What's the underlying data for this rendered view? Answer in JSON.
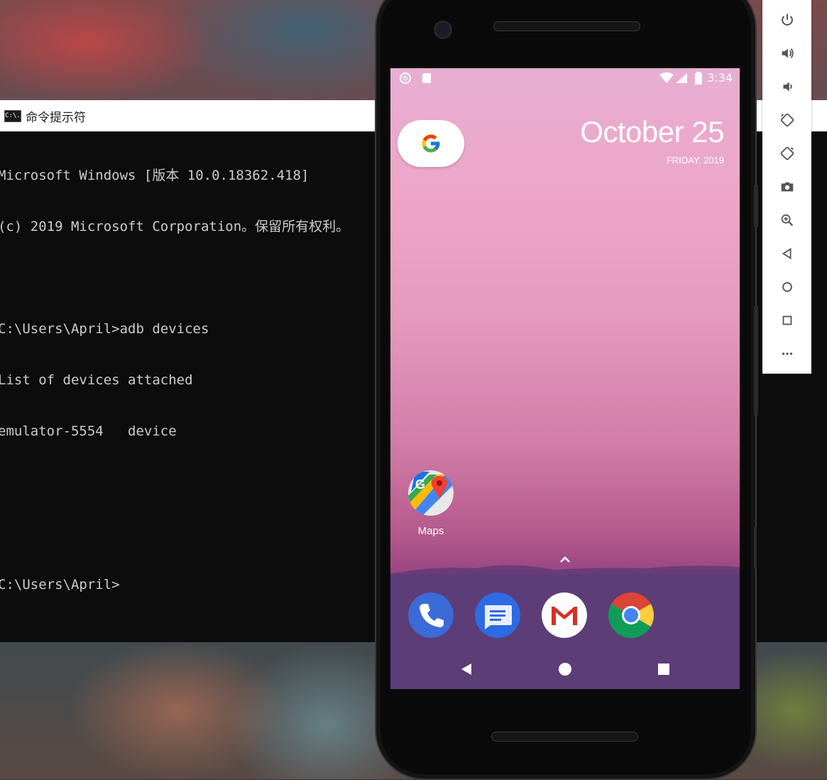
{
  "cmd": {
    "title": "命令提示符",
    "icon_text": "C:\\.",
    "lines": [
      "Microsoft Windows [版本 10.0.18362.418]",
      "(c) 2019 Microsoft Corporation。保留所有权利。",
      "",
      "C:\\Users\\April>adb devices",
      "List of devices attached",
      "emulator-5554   device",
      "",
      "",
      "C:\\Users\\April>"
    ]
  },
  "phone": {
    "status_time": "3:34",
    "date_main": "October 25",
    "date_sub": "FRIDAY, 2019",
    "apps": [
      {
        "label": "Maps",
        "icon": "maps-icon"
      }
    ],
    "dock": [
      "phone-icon",
      "messages-icon",
      "gmail-icon",
      "chrome-icon"
    ],
    "nav": [
      "back-icon",
      "home-icon",
      "recents-icon"
    ]
  },
  "toolbar": {
    "buttons": [
      "power-icon",
      "volume-up-icon",
      "volume-down-icon",
      "rotate-left-icon",
      "rotate-right-icon",
      "camera-icon",
      "zoom-icon",
      "back-icon",
      "home-icon",
      "overview-icon",
      "more-icon"
    ]
  },
  "colors": {
    "cmd_bg": "#0c0c0c",
    "cmd_text": "#cccccc",
    "dock": "#5c3d78"
  }
}
